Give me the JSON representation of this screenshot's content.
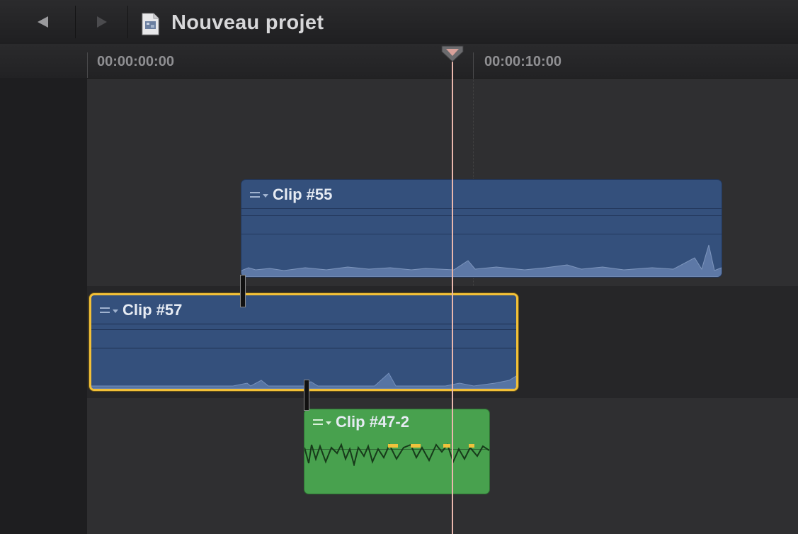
{
  "header": {
    "back_icon": "triangle-left-icon",
    "forward_icon": "triangle-right-icon",
    "project_icon": "document-icon",
    "project_title": "Nouveau projet"
  },
  "ruler": {
    "timecodes": [
      "00:00:00:00",
      "00:00:10:00"
    ]
  },
  "playhead": {
    "icon": "playhead-icon",
    "color": "#e9b7ad"
  },
  "clips": [
    {
      "name": "Clip #55",
      "kind": "connected-above",
      "color": "#34507c",
      "selected": false,
      "icon": "clip-options-icon"
    },
    {
      "name": "Clip #57",
      "kind": "primary-storyline",
      "color": "#34507c",
      "selected": true,
      "selection_color": "#f2c038",
      "icon": "clip-options-icon"
    },
    {
      "name": "Clip #47-2",
      "kind": "connected-below",
      "color": "#48a14e",
      "selected": false,
      "icon": "clip-options-icon"
    }
  ],
  "colors": {
    "background": "#2f2f31",
    "primary_lane": "#262628",
    "audio_clip": "#48a14e",
    "video_clip": "#34507c",
    "selection": "#f2c038"
  }
}
